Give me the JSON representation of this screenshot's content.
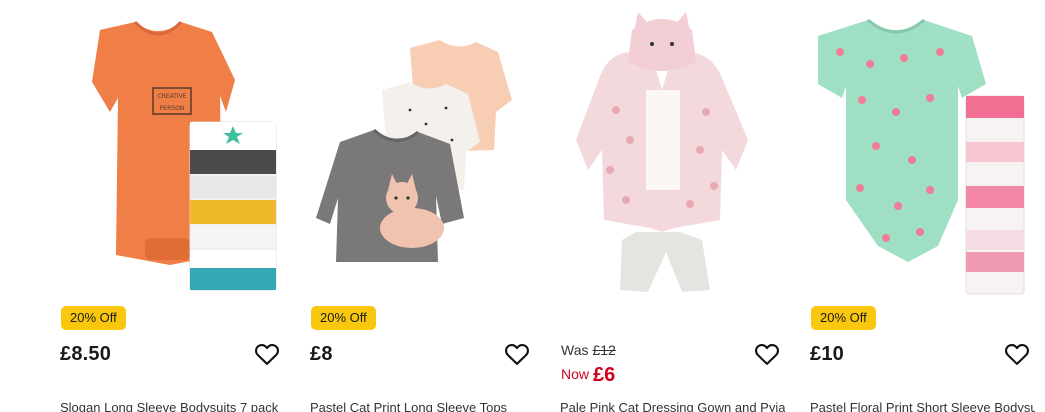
{
  "products": [
    {
      "badge": "20% Off",
      "price": "£8.50",
      "name": "Slogan Long Sleeve Bodysuits 7 pack",
      "wishlist_icon": "heart-outline-icon"
    },
    {
      "badge": "20% Off",
      "price": "£8",
      "name": "Pastel Cat Print Long Sleeve Tops",
      "wishlist_icon": "heart-outline-icon"
    },
    {
      "was_label": "Was",
      "was_price": "£12",
      "now_label": "Now",
      "now_price": "£6",
      "name": "Pale Pink Cat Dressing Gown and Pyjamas",
      "wishlist_icon": "heart-outline-icon"
    },
    {
      "badge": "20% Off",
      "price": "£10",
      "name": "Pastel Floral Print Short Sleeve Bodysuits",
      "wishlist_icon": "heart-outline-icon"
    }
  ],
  "colors": {
    "badge_bg": "#f9c80e",
    "sale_red": "#d0021b"
  }
}
